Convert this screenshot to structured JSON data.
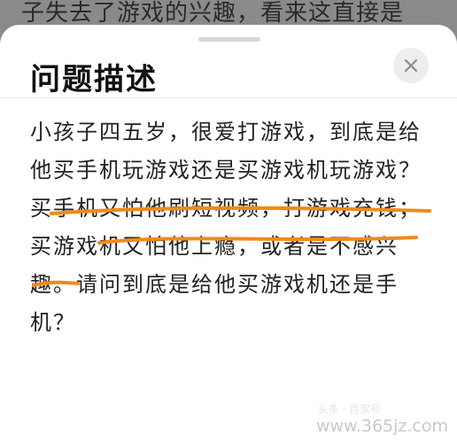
{
  "background": {
    "partial_text": "子失去了游戏的兴趣，看来这直接是"
  },
  "sheet": {
    "title": "问题描述",
    "close_icon": "close-icon",
    "body_lines": [
      "小孩子四五岁，很爱打游戏，到底是给",
      "他买手机玩游戏还是买游戏机玩游戏？",
      "买手机又怕他刷短视频，打游戏充钱；",
      "买游戏机又怕他上瘾，或者是不感兴",
      "趣。请问到底是给他买游戏机还是手",
      "机？"
    ],
    "annotation_color": "#f08a1a"
  },
  "watermark": {
    "text": "www.365jz.com"
  }
}
